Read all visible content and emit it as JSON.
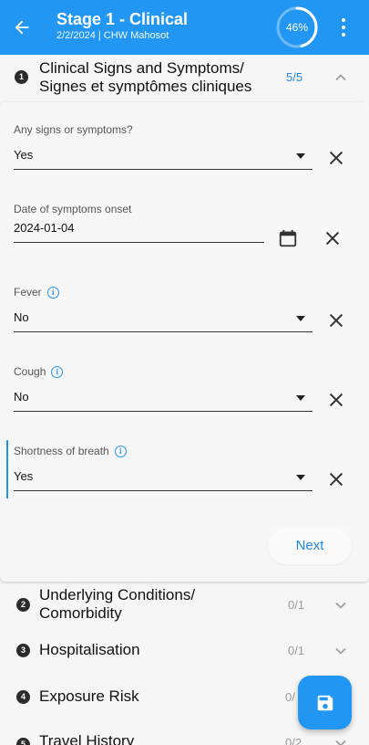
{
  "header": {
    "title": "Stage 1 - Clinical",
    "subtitle": "2/2/2024 | CHW Mahosot",
    "progress_text": "46%",
    "progress_value": 0.46,
    "back_icon": "arrow-left-icon",
    "menu_icon": "more-vert-icon"
  },
  "colors": {
    "primary": "#2196f3",
    "text": "#111111",
    "muted": "#999999",
    "background": "#f6f6f6"
  },
  "section1": {
    "number": "1",
    "title_line1": "Clinical Signs and Symptoms/",
    "title_line2": "Signes et symptômes cliniques",
    "count": "5/5",
    "expanded": true
  },
  "fields": {
    "any_signs": {
      "label": "Any signs or symptoms?",
      "value": "Yes"
    },
    "onset": {
      "label": "Date of symptoms onset",
      "value": "2024-01-04"
    },
    "fever": {
      "label": "Fever",
      "value": "No"
    },
    "cough": {
      "label": "Cough",
      "value": "No"
    },
    "sob": {
      "label": "Shortness of breath",
      "value": "Yes"
    }
  },
  "next_label": "Next",
  "sections": [
    {
      "number": "2",
      "title_line1": "Underlying Conditions/",
      "title_line2": "Comorbidity",
      "count": "0/1"
    },
    {
      "number": "3",
      "title": "Hospitalisation",
      "count": "0/1"
    },
    {
      "number": "4",
      "title": "Exposure Risk",
      "count": "0/"
    },
    {
      "number": "5",
      "title": "Travel History",
      "count": "0/2"
    }
  ],
  "fab_icon": "save-icon"
}
